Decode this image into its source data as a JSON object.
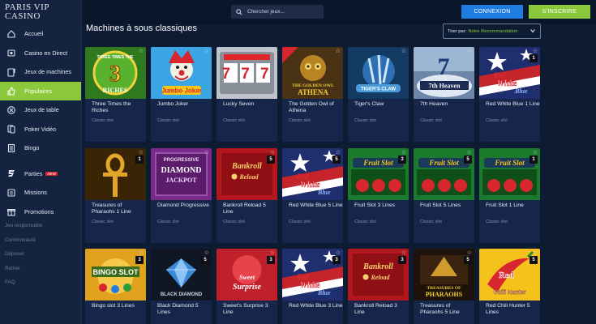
{
  "logo": {
    "line1": "PARIS VIP",
    "line2": "CASINO"
  },
  "sidebar": {
    "items": [
      {
        "label": "Accueil",
        "icon": "home-icon"
      },
      {
        "label": "Casino en Direct",
        "icon": "live-casino-icon"
      },
      {
        "label": "Jeux de machines",
        "icon": "slot-machine-icon"
      },
      {
        "label": "Populaires",
        "icon": "thumbs-up-icon",
        "active": true
      },
      {
        "label": "Jeux de table",
        "icon": "table-games-icon"
      },
      {
        "label": "Poker Vidéo",
        "icon": "video-poker-icon"
      },
      {
        "label": "Bingo",
        "icon": "bingo-icon"
      }
    ],
    "items2": [
      {
        "label": "Parties",
        "icon": "parties-icon",
        "badge": "NEW"
      },
      {
        "label": "Missions",
        "icon": "missions-icon"
      },
      {
        "label": "Promotions",
        "icon": "gift-icon"
      }
    ],
    "links": [
      "Jeu responsable",
      "Communauté",
      "Déposer",
      "Retirer",
      "FAQ"
    ]
  },
  "topbar": {
    "search_placeholder": "Chercher jeux...",
    "connexion": "CONNEXION",
    "inscrire": "S'INSCRIRE"
  },
  "main": {
    "title": "Machines à sous classiques",
    "sort_label": "Trier par:",
    "sort_value": "Notre Recommandation"
  },
  "games": [
    {
      "title": "Three Times the Riches",
      "category": "Classic slot",
      "lines": "",
      "art": "3x"
    },
    {
      "title": "Jumbo Joker",
      "category": "Classic slot",
      "lines": "",
      "art": "joker"
    },
    {
      "title": "Lucky Seven",
      "category": "Classic slot",
      "lines": "",
      "art": "777"
    },
    {
      "title": "The Golden Owl of Athena",
      "category": "Classic slot",
      "lines": "",
      "art": "owl"
    },
    {
      "title": "Tiger's Claw",
      "category": "Classic slot",
      "lines": "",
      "art": "tiger"
    },
    {
      "title": "7th Heaven",
      "category": "Classic slot",
      "lines": "",
      "art": "heaven"
    },
    {
      "title": "Red White Blue 1 Line",
      "category": "Classic slot",
      "lines": "1",
      "art": "rwb"
    },
    {
      "title": "Treasures of Pharaohs 1 Line",
      "category": "Classic slot",
      "lines": "1",
      "art": "ankh"
    },
    {
      "title": "Diamond Progressive",
      "category": "Classic slot",
      "lines": "",
      "art": "diamondprog"
    },
    {
      "title": "Bankroll Reload 5 Line",
      "category": "Classic slot",
      "lines": "5",
      "art": "bankroll"
    },
    {
      "title": "Red White Blue 5 Line",
      "category": "Classic slot",
      "lines": "5",
      "art": "rwb"
    },
    {
      "title": "Fruit Slot 3 Lines",
      "category": "Classic slot",
      "lines": "3",
      "art": "fruit"
    },
    {
      "title": "Fruit Slot 5 Lines",
      "category": "Classic slot",
      "lines": "5",
      "art": "fruit"
    },
    {
      "title": "Fruit Slot 1 Line",
      "category": "Classic slot",
      "lines": "1",
      "art": "fruit"
    },
    {
      "title": "Bingo slot 3 Lines",
      "category": "",
      "lines": "3",
      "art": "bingo"
    },
    {
      "title": "Black Diamond 5 Lines",
      "category": "",
      "lines": "5",
      "art": "blackdiamond"
    },
    {
      "title": "Sweet's Surprise 3 Line",
      "category": "",
      "lines": "3",
      "art": "sweet"
    },
    {
      "title": "Red White Blue 3 Line",
      "category": "",
      "lines": "3",
      "art": "rwb"
    },
    {
      "title": "Bankroll Reload 3 Line",
      "category": "",
      "lines": "3",
      "art": "bankroll"
    },
    {
      "title": "Treasures of Pharaohs 5 Line",
      "category": "",
      "lines": "5",
      "art": "pharaohs"
    },
    {
      "title": "Red Chili Hunter 5 Lines",
      "category": "",
      "lines": "5",
      "art": "chili"
    }
  ],
  "art_text": {
    "3x": [
      "THREE TIMES THE",
      "3",
      "RICHES"
    ],
    "joker": [
      "Jumbo Joker"
    ],
    "777": [
      "7 7 7"
    ],
    "owl": [
      "THE GOLDEN OWL",
      "ATHENA"
    ],
    "tiger": [
      "TIGER'S CLAW"
    ],
    "heaven": [
      "7th Heaven"
    ],
    "rwb": [
      "Red",
      "White",
      "Blue"
    ],
    "ankh": [],
    "diamondprog": [
      "PROGRESSIVE",
      "DIAMOND",
      "JACKPOT"
    ],
    "bankroll": [
      "Bankroll",
      "Reload"
    ],
    "fruit": [
      "Fruit Slot"
    ],
    "bingo": [
      "BINGO SLOT"
    ],
    "blackdiamond": [
      "BLACK DIAMOND"
    ],
    "sweet": [
      "Sweet",
      "Surprise"
    ],
    "pharaohs": [
      "TREASURES OF",
      "PHARAOHS"
    ],
    "chili": [
      "Red",
      "Chili Hunter"
    ]
  }
}
